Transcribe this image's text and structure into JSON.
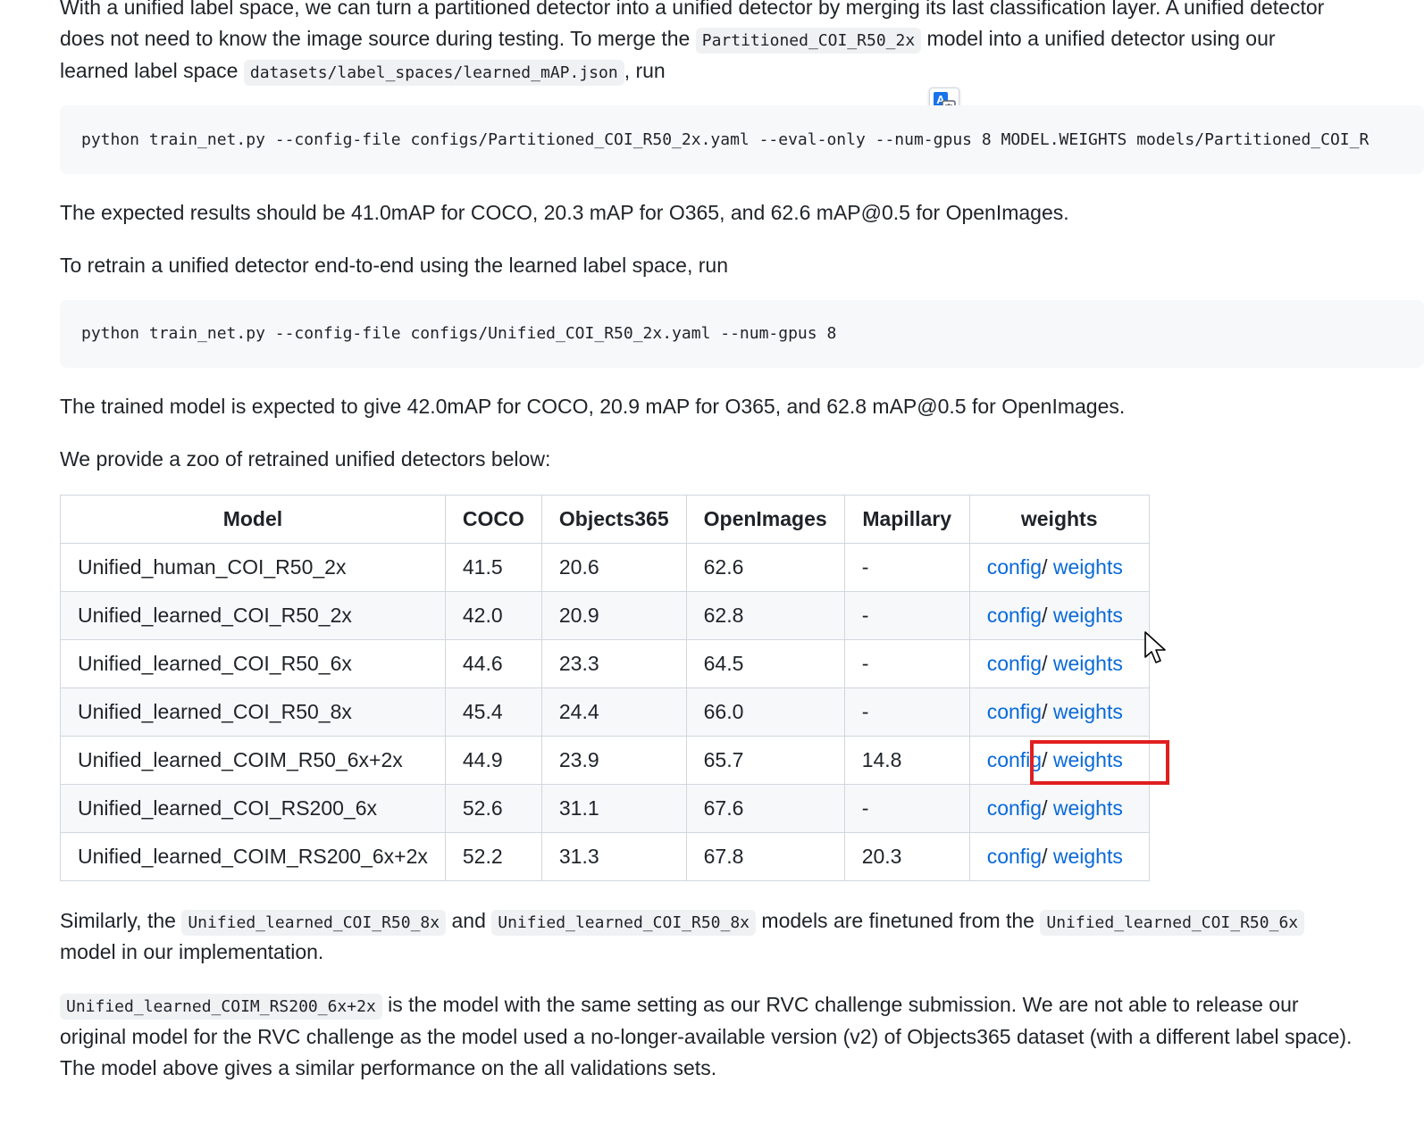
{
  "intro": {
    "line1": "With a unified label space, we can turn a partitioned detector into a unified detector by merging its last classification layer. A unified detector",
    "line2_a": "does not need to know the image source during testing. To merge the ",
    "line2_code": "Partitioned_COI_R50_2x",
    "line2_b": " model into a unified detector using our",
    "line3_a": "learned label space ",
    "line3_code": "datasets/label_spaces/learned_mAP.json",
    "line3_b": ", run"
  },
  "code1": "python train_net.py --config-file configs/Partitioned_COI_R50_2x.yaml --eval-only --num-gpus 8 MODEL.WEIGHTS models/Partitioned_COI_R",
  "expected1": "The expected results should be 41.0mAP for COCO, 20.3 mAP for O365, and 62.6 mAP@0.5 for OpenImages.",
  "retrain_text": "To retrain a unified detector end-to-end using the learned label space, run",
  "code2": "python train_net.py --config-file configs/Unified_COI_R50_2x.yaml --num-gpus 8",
  "expected2": "The trained model is expected to give 42.0mAP for COCO, 20.9 mAP for O365, and 62.8 mAP@0.5 for OpenImages.",
  "zoo_text": "We provide a zoo of retrained unified detectors below:",
  "table": {
    "headers": [
      "Model",
      "COCO",
      "Objects365",
      "OpenImages",
      "Mapillary",
      "weights"
    ],
    "rows": [
      {
        "model": "Unified_human_COI_R50_2x",
        "coco": "41.5",
        "o365": "20.6",
        "oi": "62.6",
        "map": "-"
      },
      {
        "model": "Unified_learned_COI_R50_2x",
        "coco": "42.0",
        "o365": "20.9",
        "oi": "62.8",
        "map": "-"
      },
      {
        "model": "Unified_learned_COI_R50_6x",
        "coco": "44.6",
        "o365": "23.3",
        "oi": "64.5",
        "map": "-"
      },
      {
        "model": "Unified_learned_COI_R50_8x",
        "coco": "45.4",
        "o365": "24.4",
        "oi": "66.0",
        "map": "-"
      },
      {
        "model": "Unified_learned_COIM_R50_6x+2x",
        "coco": "44.9",
        "o365": "23.9",
        "oi": "65.7",
        "map": "14.8"
      },
      {
        "model": "Unified_learned_COI_RS200_6x",
        "coco": "52.6",
        "o365": "31.1",
        "oi": "67.6",
        "map": "-"
      },
      {
        "model": "Unified_learned_COIM_RS200_6x+2x",
        "coco": "52.2",
        "o365": "31.3",
        "oi": "67.8",
        "map": "20.3"
      }
    ],
    "link_config": "config",
    "link_sep": "/ ",
    "link_weights": "weights"
  },
  "similarly": {
    "a": "Similarly, the ",
    "code1": "Unified_learned_COI_R50_8x",
    "b": " and ",
    "code2": "Unified_learned_COI_R50_8x",
    "c": " models are finetuned from the ",
    "code3": "Unified_learned_COI_R50_6x",
    "line2": "model in our implementation."
  },
  "rvc": {
    "code": "Unified_learned_COIM_RS200_6x+2x",
    "a": " is the model with the same setting as our RVC challenge submission. We are not able to release our",
    "line2": "original model for the RVC challenge as the model used a no-longer-available version (v2) of Objects365 dataset (with a different label space).",
    "line3": "The model above gives a similar performance on the all validations sets."
  },
  "colors": {
    "link": "#0969da",
    "highlight": "#e01f1f",
    "code_bg": "#f6f8fa"
  },
  "icons": {
    "translate": "translate-icon",
    "cursor": "mouse-pointer-icon"
  }
}
